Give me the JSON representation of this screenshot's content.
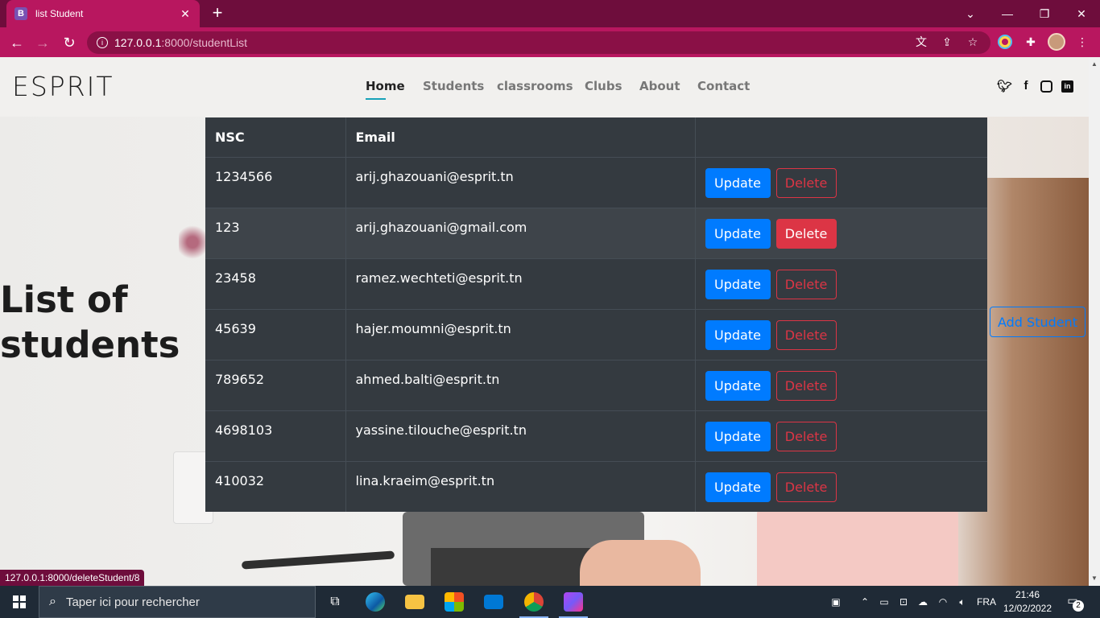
{
  "browser": {
    "tab_title": "list Student",
    "tab_favicon": "B",
    "url_host": "127.0.0.1",
    "url_path": ":8000/studentList",
    "status_url": "127.0.0.1:8000/deleteStudent/8"
  },
  "navbar": {
    "brand": "ESPRIT",
    "items": [
      "Home",
      "Students",
      "classrooms",
      "Clubs",
      "About",
      "Contact"
    ],
    "active": "Home",
    "social": [
      "twitter-icon",
      "facebook-icon",
      "instagram-icon",
      "linkedin-icon"
    ]
  },
  "hero": {
    "title_line1": "List of",
    "title_line2": "students"
  },
  "table": {
    "headers": [
      "NSC",
      "Email",
      ""
    ],
    "rows": [
      {
        "nsc": "1234566",
        "email": "arij.ghazouani@esprit.tn"
      },
      {
        "nsc": "123",
        "email": "arij.ghazouani@gmail.com"
      },
      {
        "nsc": "23458",
        "email": "ramez.wechteti@esprit.tn"
      },
      {
        "nsc": "45639",
        "email": "hajer.moumni@esprit.tn"
      },
      {
        "nsc": "789652",
        "email": "ahmed.balti@esprit.tn"
      },
      {
        "nsc": "4698103",
        "email": "yassine.tilouche@esprit.tn"
      },
      {
        "nsc": "410032",
        "email": "lina.kraeim@esprit.tn"
      }
    ],
    "update_label": "Update",
    "delete_label": "Delete"
  },
  "add_button": "Add Student",
  "taskbar": {
    "search_placeholder": "Taper ici pour rechercher",
    "language": "FRA",
    "time": "21:46",
    "date": "12/02/2022",
    "notification_count": "2"
  },
  "colors": {
    "browser_frame": "#6e0d3c",
    "browser_toolbar": "#b8175f",
    "table_bg": "#343a40",
    "primary": "#007bff",
    "danger": "#dc3545",
    "nav_active_underline": "#17a2b8"
  }
}
